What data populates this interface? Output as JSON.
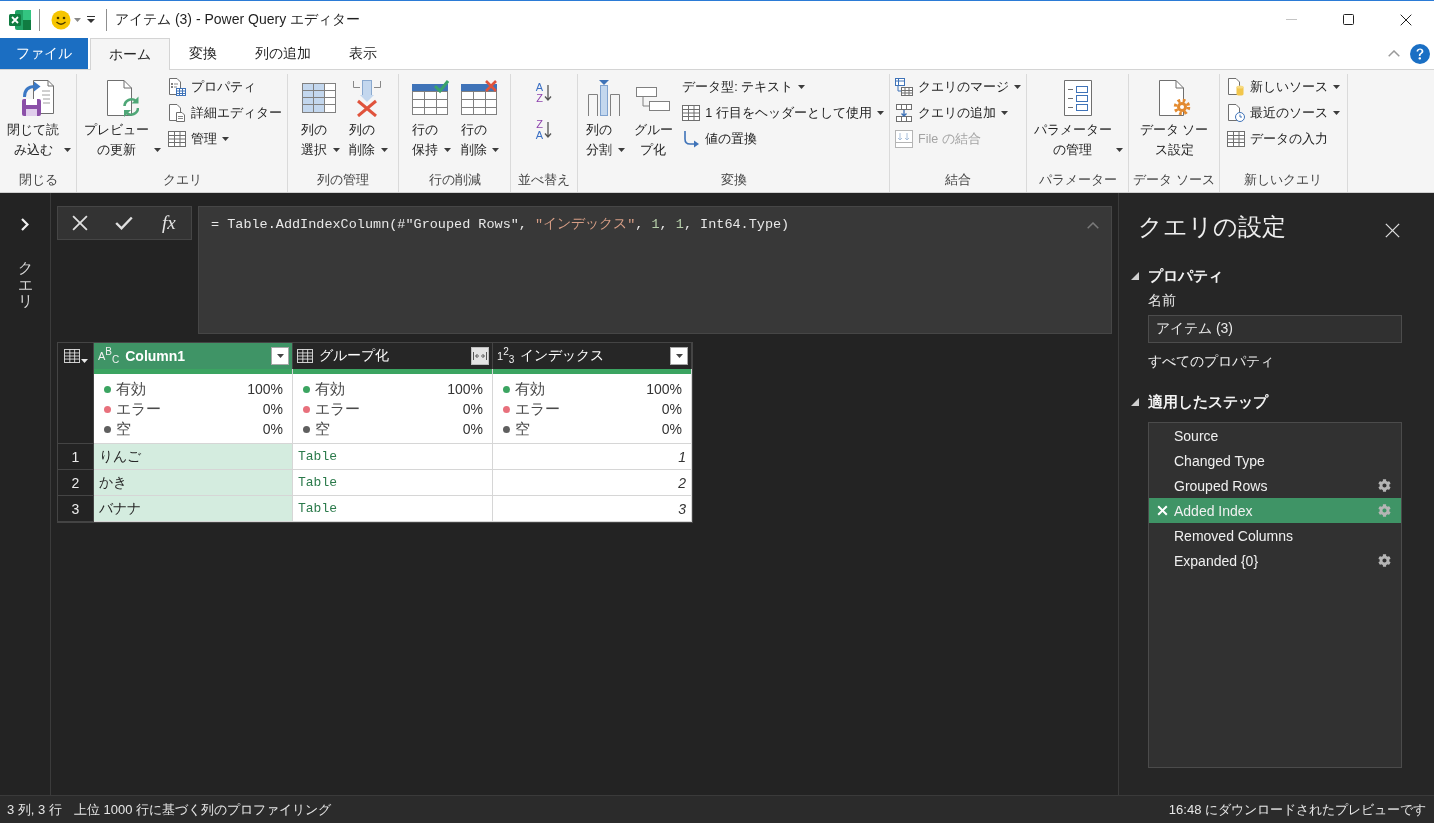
{
  "window": {
    "title": "アイテム (3) - Power Query エディター"
  },
  "ribbon_tabs": [
    {
      "label": "ファイル",
      "kind": "backstage",
      "selected": false
    },
    {
      "label": "ホーム",
      "kind": "tab",
      "selected": true
    },
    {
      "label": "変換",
      "kind": "tab",
      "selected": false
    },
    {
      "label": "列の追加",
      "kind": "tab",
      "selected": false
    },
    {
      "label": "表示",
      "kind": "tab",
      "selected": false
    }
  ],
  "ribbon_groups": [
    {
      "label": "閉じる",
      "items": [
        {
          "kind": "large",
          "label": "閉じて読み込む",
          "dropdown": true
        }
      ]
    },
    {
      "label": "クエリ",
      "items": [
        {
          "kind": "large",
          "label": "プレビューの更新",
          "dropdown": true
        },
        {
          "kind": "small",
          "label": "プロパティ",
          "dropdown": false
        },
        {
          "kind": "small",
          "label": "詳細エディター",
          "dropdown": false
        },
        {
          "kind": "small",
          "label": "管理",
          "dropdown": true
        }
      ]
    },
    {
      "label": "列の管理",
      "items": [
        {
          "kind": "large",
          "label": "列の選択",
          "dropdown": true
        },
        {
          "kind": "large",
          "label": "列の削除",
          "dropdown": true
        }
      ]
    },
    {
      "label": "行の削減",
      "items": [
        {
          "kind": "large",
          "label": "行の保持",
          "dropdown": true
        },
        {
          "kind": "large",
          "label": "行の削除",
          "dropdown": true
        }
      ]
    },
    {
      "label": "並べ替え",
      "items": [
        {
          "kind": "sort",
          "letters": [
            "A",
            "Z"
          ]
        },
        {
          "kind": "sort",
          "letters": [
            "Z",
            "A"
          ]
        }
      ]
    },
    {
      "label": "変換",
      "items": [
        {
          "kind": "large",
          "label": "列の分割",
          "dropdown": true
        },
        {
          "kind": "large",
          "label": "グループ化",
          "dropdown": false
        },
        {
          "kind": "small",
          "label": "データ型: テキスト",
          "dropdown": true
        },
        {
          "kind": "small",
          "label": "1 行目をヘッダーとして使用",
          "dropdown": true
        },
        {
          "kind": "small",
          "label": "値の置換",
          "dropdown": false
        }
      ]
    },
    {
      "label": "結合",
      "items": [
        {
          "kind": "small",
          "label": "クエリのマージ",
          "dropdown": true,
          "disabled": false
        },
        {
          "kind": "small",
          "label": "クエリの追加",
          "dropdown": true,
          "disabled": false
        },
        {
          "kind": "small",
          "label": "File の結合",
          "dropdown": false,
          "disabled": true
        }
      ]
    },
    {
      "label": "パラメーター",
      "items": [
        {
          "kind": "large",
          "label": "パラメーターの管理",
          "dropdown": true
        }
      ]
    },
    {
      "label": "データ ソース",
      "items": [
        {
          "kind": "large",
          "label": "データ ソース設定",
          "dropdown": false
        }
      ]
    },
    {
      "label": "新しいクエリ",
      "items": [
        {
          "kind": "small",
          "label": "新しいソース",
          "dropdown": true
        },
        {
          "kind": "small",
          "label": "最近のソース",
          "dropdown": true
        },
        {
          "kind": "small",
          "label": "データの入力",
          "dropdown": false
        }
      ]
    }
  ],
  "queries_pane": {
    "label": "クエリ",
    "expanded": false
  },
  "formula_bar": {
    "function_label": "fx",
    "formula": [
      {
        "kind": "code",
        "text": "= Table.AddIndexColumn(#\"Grouped Rows\", "
      },
      {
        "kind": "string",
        "text": "\"インデックス\""
      },
      {
        "kind": "code",
        "text": ", "
      },
      {
        "kind": "number",
        "text": "1"
      },
      {
        "kind": "code",
        "text": ", "
      },
      {
        "kind": "number",
        "text": "1"
      },
      {
        "kind": "code",
        "text": ", Int64.Type)"
      }
    ]
  },
  "table": {
    "columns": [
      {
        "name": "Column1",
        "kind": "text",
        "type_mark": "A$^{B}$$_{C}$",
        "selected": true,
        "quality_bar": {
          "level": 1
        },
        "quality": [
          {
            "label": "有効",
            "value": "100%",
            "color": "#3ba461"
          },
          {
            "label": "エラー",
            "value": "0%",
            "color": "#e8707c"
          },
          {
            "label": "空",
            "value": "0%",
            "color": "#5f5f5f"
          }
        ]
      },
      {
        "name": "グループ化",
        "kind": "table",
        "selected": false,
        "quality_bar": {
          "level": 1
        },
        "quality": [
          {
            "label": "有効",
            "value": "100%",
            "color": "#3ba461"
          },
          {
            "label": "エラー",
            "value": "0%",
            "color": "#e8707c"
          },
          {
            "label": "空",
            "value": "0%",
            "color": "#5f5f5f"
          }
        ]
      },
      {
        "name": "インデックス",
        "kind": "number",
        "type_mark": "1$^{2}$$_{3}$",
        "selected": false,
        "quality_bar": {
          "level": 1
        },
        "quality": [
          {
            "label": "有効",
            "value": "100%",
            "color": "#3ba461"
          },
          {
            "label": "エラー",
            "value": "0%",
            "color": "#e8707c"
          },
          {
            "label": "空",
            "value": "0%",
            "color": "#5f5f5f"
          }
        ]
      }
    ],
    "rows": [
      {
        "number": "1",
        "cells": [
          "りんご",
          "Table",
          "1"
        ]
      },
      {
        "number": "2",
        "cells": [
          "かき",
          "Table",
          "2"
        ]
      },
      {
        "number": "3",
        "cells": [
          "バナナ",
          "Table",
          "3"
        ]
      }
    ]
  },
  "query_settings": {
    "title": "クエリの設定",
    "properties": {
      "heading": "プロパティ",
      "expanded": true,
      "name_label": "名前",
      "name_value": "アイテム (3)",
      "link": "すべてのプロパティ"
    },
    "applied_steps": {
      "heading": "適用したステップ",
      "expanded": true,
      "steps": [
        {
          "label": "Source",
          "selected": false,
          "settings": false
        },
        {
          "label": "Changed Type",
          "selected": false,
          "settings": false
        },
        {
          "label": "Grouped Rows",
          "selected": false,
          "settings": true
        },
        {
          "label": "Added Index",
          "selected": true,
          "settings": true
        },
        {
          "label": "Removed Columns",
          "selected": false,
          "settings": false
        },
        {
          "label": "Expanded {0}",
          "selected": false,
          "settings": true
        }
      ]
    }
  },
  "status_bar": {
    "left": [
      "3 列, 3 行",
      "上位 1000 行に基づく列のプロファイリング"
    ],
    "right": "16:48 にダウンロードされたプレビューです"
  }
}
